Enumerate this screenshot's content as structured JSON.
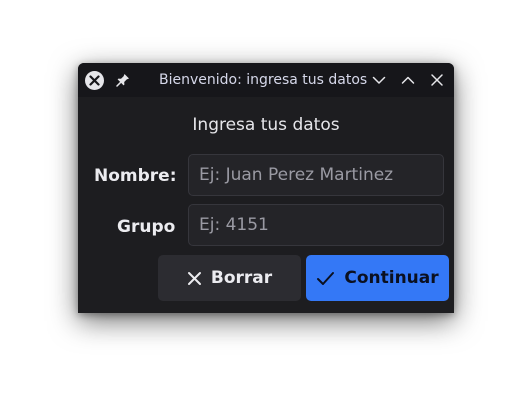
{
  "window": {
    "title": "Bienvenido: ingresa tus datos"
  },
  "form": {
    "heading": "Ingresa tus datos",
    "nombre_label": "Nombre:",
    "nombre_placeholder": "Ej: Juan Perez Martinez",
    "grupo_label": "Grupo",
    "grupo_placeholder": "Ej: 4151"
  },
  "buttons": {
    "borrar_label": "Borrar",
    "borrar_icon": "x-icon",
    "continuar_label": "Continuar",
    "continuar_icon": "checkmark-icon"
  },
  "colors": {
    "window_bg": "#1d1d20",
    "titlebar_bg": "#16161a",
    "accent": "#3478f6",
    "secondary_button": "#2c2c31"
  }
}
